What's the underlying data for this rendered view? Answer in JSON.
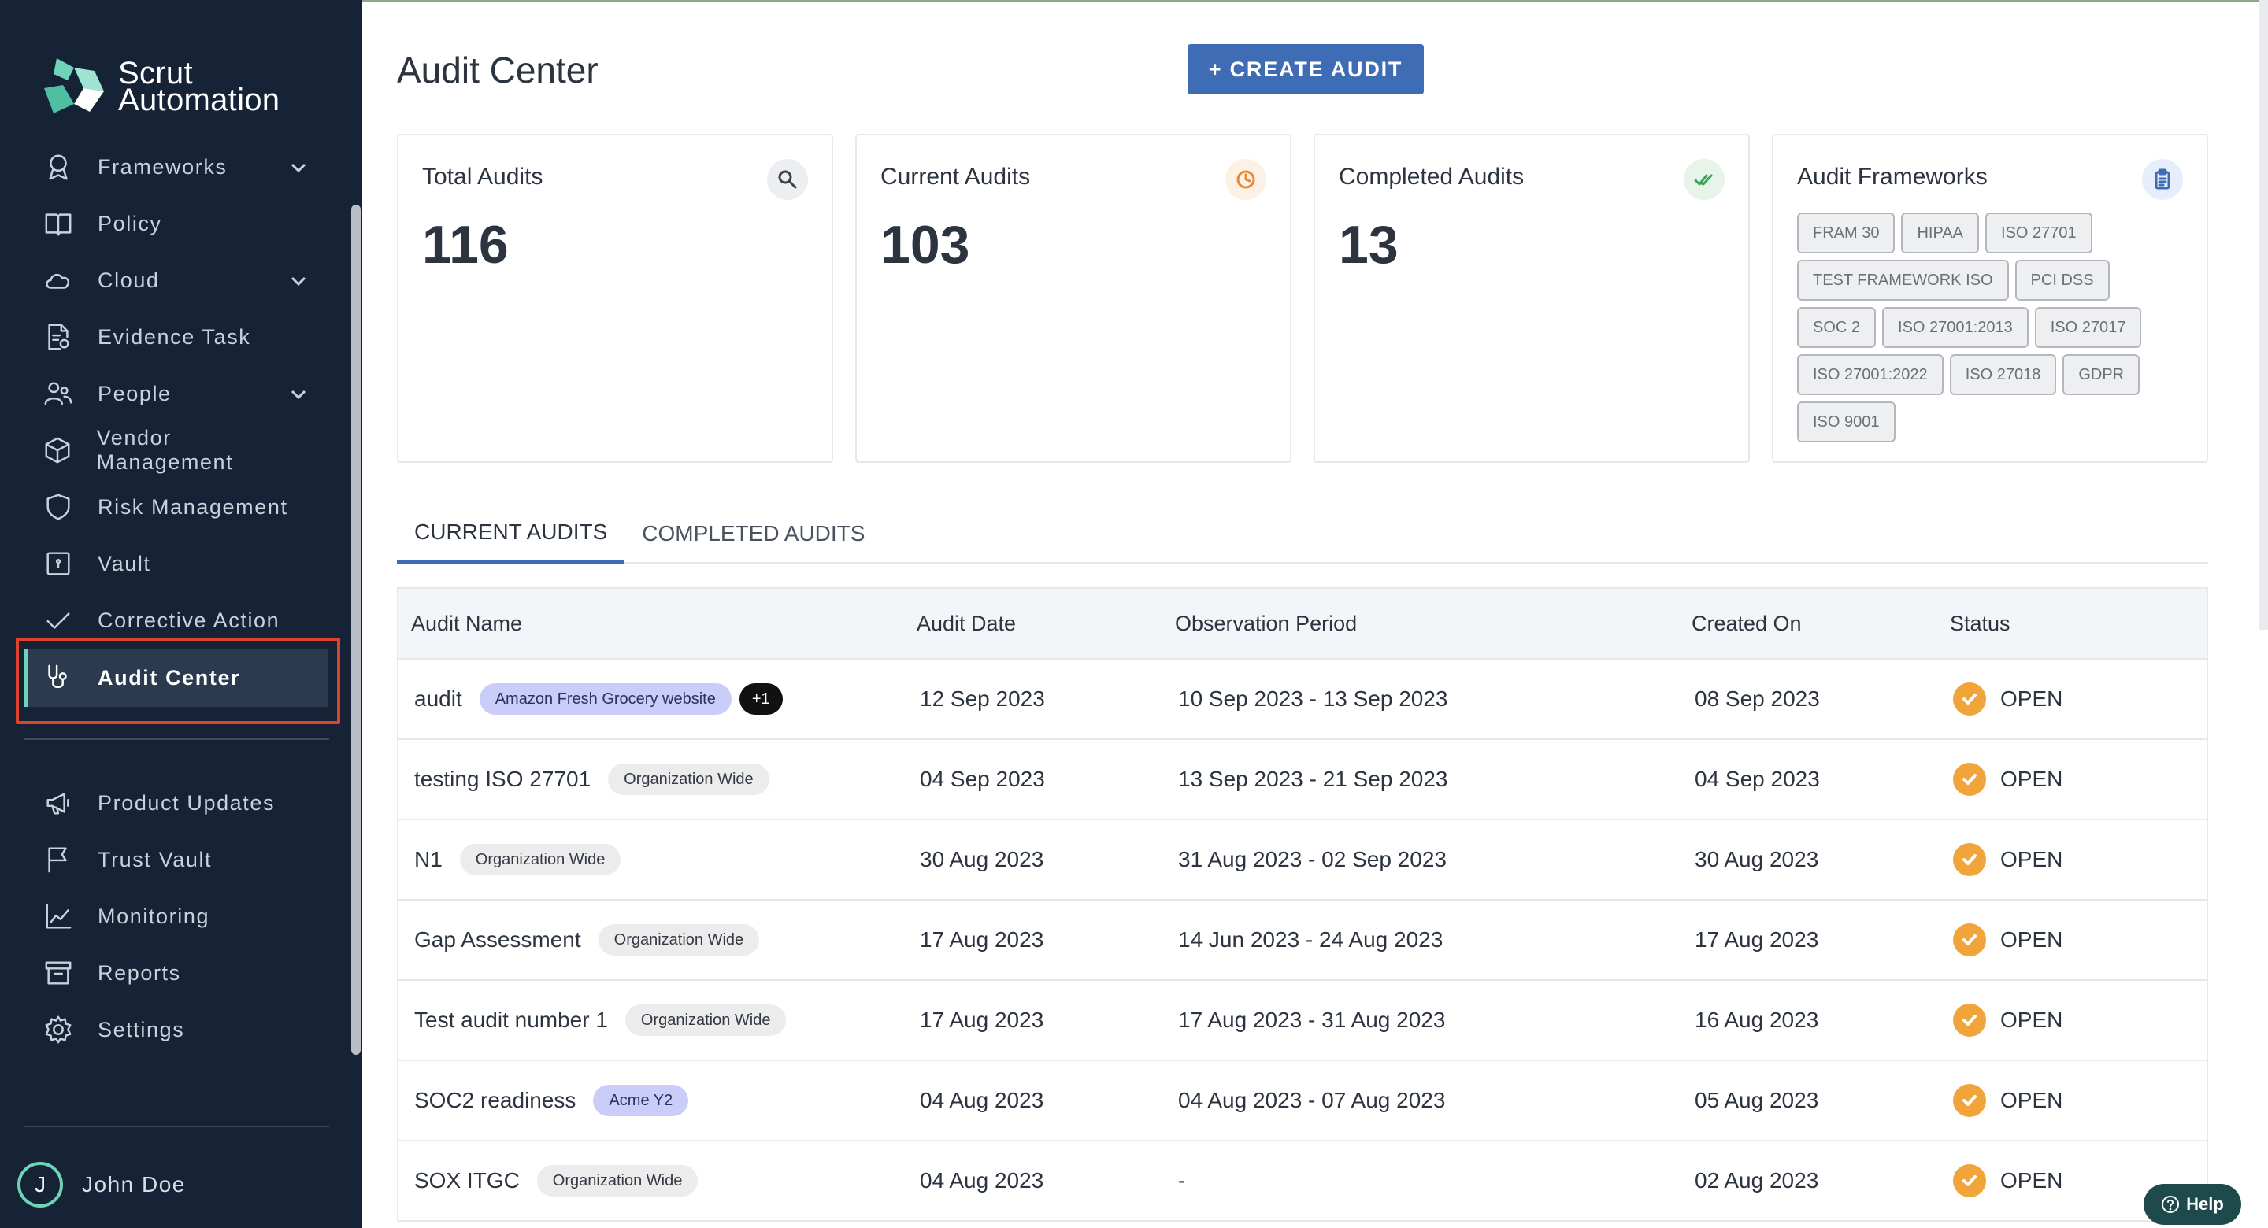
{
  "brand": {
    "line1": "Scrut",
    "line2": "Automation"
  },
  "nav": {
    "items": [
      {
        "label": "Frameworks",
        "icon": "frameworks-icon",
        "expandable": true
      },
      {
        "label": "Policy",
        "icon": "book-icon",
        "expandable": false
      },
      {
        "label": "Cloud",
        "icon": "cloud-icon",
        "expandable": true
      },
      {
        "label": "Evidence Task",
        "icon": "evidence-icon",
        "expandable": false
      },
      {
        "label": "People",
        "icon": "people-icon",
        "expandable": true
      },
      {
        "label": "Vendor Management",
        "icon": "box-icon",
        "expandable": false
      },
      {
        "label": "Risk Management",
        "icon": "shield-icon",
        "expandable": false
      },
      {
        "label": "Vault",
        "icon": "vault-icon",
        "expandable": false
      },
      {
        "label": "Corrective Action",
        "icon": "check-icon",
        "expandable": false
      },
      {
        "label": "Audit Center",
        "icon": "stethoscope-icon",
        "active": true
      }
    ],
    "bottom_items": [
      {
        "label": "Product Updates",
        "icon": "megaphone-icon"
      },
      {
        "label": "Trust Vault",
        "icon": "flag-icon"
      },
      {
        "label": "Monitoring",
        "icon": "chart-icon"
      },
      {
        "label": "Reports",
        "icon": "archive-icon"
      },
      {
        "label": "Settings",
        "icon": "gear-icon"
      }
    ]
  },
  "user": {
    "initial": "J",
    "name": "John Doe"
  },
  "page": {
    "title": "Audit Center",
    "create_button": "+ CREATE AUDIT"
  },
  "cards": {
    "total": {
      "title": "Total Audits",
      "value": "116"
    },
    "current": {
      "title": "Current Audits",
      "value": "103"
    },
    "completed": {
      "title": "Completed Audits",
      "value": "13"
    },
    "frameworks": {
      "title": "Audit Frameworks",
      "items": [
        "FRAM 30",
        "HIPAA",
        "ISO 27701",
        "TEST FRAMEWORK ISO",
        "PCI DSS",
        "SOC 2",
        "ISO 27001:2013",
        "ISO 27017",
        "ISO 27001:2022",
        "ISO 27018",
        "GDPR",
        "ISO 9001"
      ]
    }
  },
  "tabs": [
    {
      "label": "CURRENT AUDITS",
      "active": true
    },
    {
      "label": "COMPLETED AUDITS",
      "active": false
    }
  ],
  "table": {
    "headers": [
      "Audit Name",
      "Audit Date",
      "Observation Period",
      "Created On",
      "Status"
    ],
    "rows": [
      {
        "name": "audit",
        "tag": "Amazon Fresh Grocery website",
        "tag_style": "blue",
        "extra": "+1",
        "audit_date": "12 Sep 2023",
        "period": "10 Sep 2023 - 13 Sep 2023",
        "created": "08 Sep 2023",
        "status": "OPEN"
      },
      {
        "name": "testing ISO 27701",
        "tag": "Organization Wide",
        "tag_style": "grey",
        "audit_date": "04 Sep 2023",
        "period": "13 Sep 2023 - 21 Sep 2023",
        "created": "04 Sep 2023",
        "status": "OPEN"
      },
      {
        "name": "N1",
        "tag": "Organization Wide",
        "tag_style": "grey",
        "audit_date": "30 Aug 2023",
        "period": "31 Aug 2023 - 02 Sep 2023",
        "created": "30 Aug 2023",
        "status": "OPEN"
      },
      {
        "name": "Gap Assessment",
        "tag": "Organization Wide",
        "tag_style": "grey",
        "audit_date": "17 Aug 2023",
        "period": "14 Jun 2023 - 24 Aug 2023",
        "created": "17 Aug 2023",
        "status": "OPEN"
      },
      {
        "name": "Test audit number 1",
        "tag": "Organization Wide",
        "tag_style": "grey",
        "audit_date": "17 Aug 2023",
        "period": "17 Aug 2023 - 31 Aug 2023",
        "created": "16 Aug 2023",
        "status": "OPEN"
      },
      {
        "name": "SOC2 readiness",
        "tag": "Acme Y2",
        "tag_style": "blue",
        "audit_date": "04 Aug 2023",
        "period": "04 Aug 2023 - 07 Aug 2023",
        "created": "05 Aug 2023",
        "status": "OPEN"
      },
      {
        "name": "SOX ITGC",
        "tag": "Organization Wide",
        "tag_style": "grey",
        "audit_date": "04 Aug 2023",
        "period": "-",
        "created": "02 Aug 2023",
        "status": "OPEN"
      }
    ]
  },
  "help": {
    "label": "Help"
  },
  "colors": {
    "sidebar_bg": "#162235",
    "accent": "#3e6db5",
    "active_bar": "#6ed3b8",
    "status_open": "#f0a43a",
    "highlight": "#e0432d"
  }
}
